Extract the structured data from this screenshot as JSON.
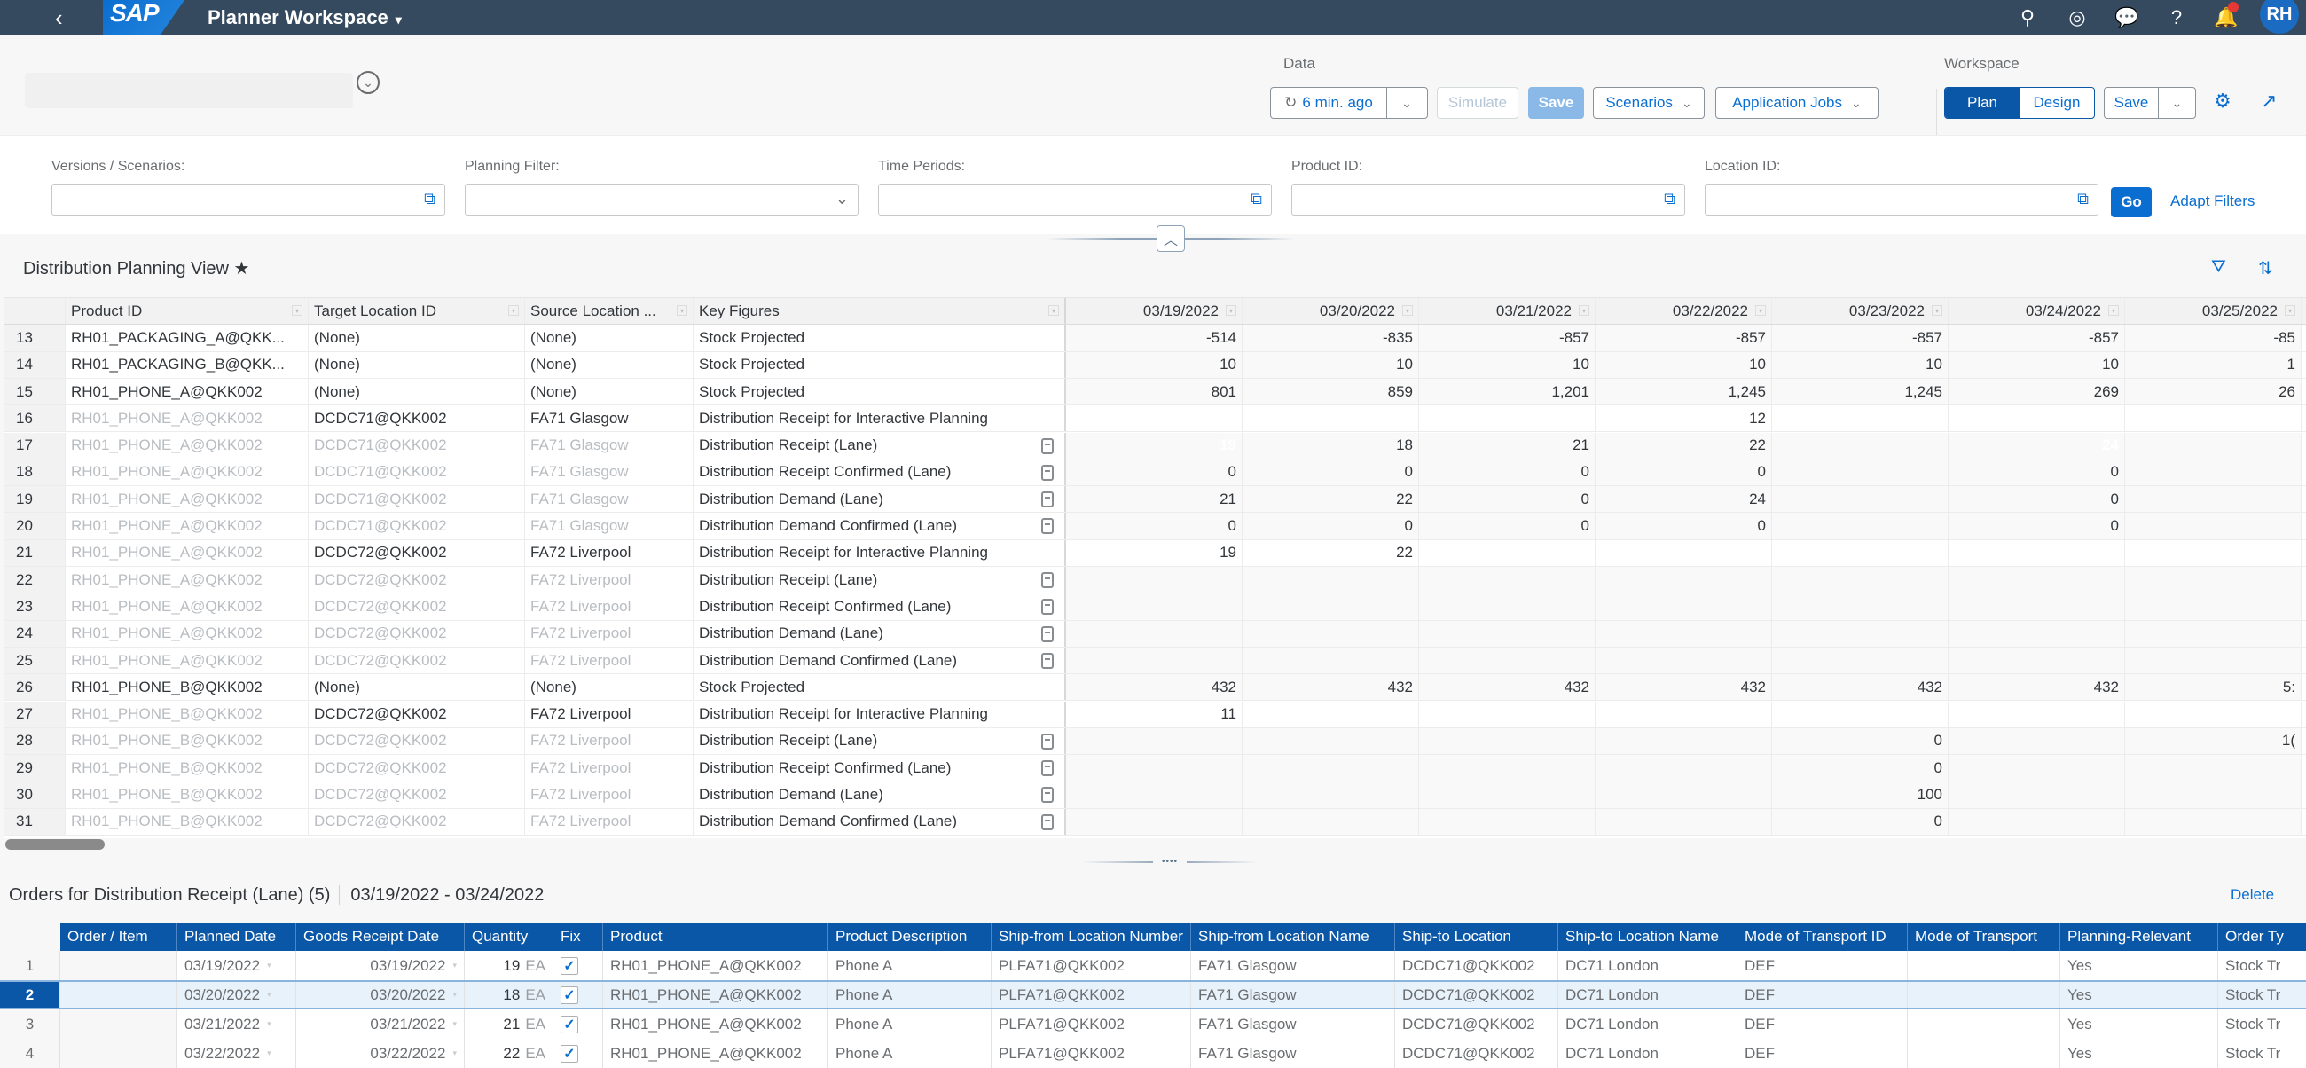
{
  "shell": {
    "back_icon": "chevron-left-icon",
    "logo": "SAP",
    "title": "Planner Workspace",
    "title_caret": "▾",
    "icons": [
      {
        "name": "search-icon",
        "glyph": "⚲"
      },
      {
        "name": "joule-icon",
        "glyph": "◎"
      },
      {
        "name": "feedback-icon",
        "glyph": "💬"
      },
      {
        "name": "help-icon",
        "glyph": "?"
      },
      {
        "name": "notifications-icon",
        "glyph": "🔔"
      }
    ],
    "avatar": "RH"
  },
  "header": {
    "data_group_label": "Data",
    "refresh_label": "6 min. ago",
    "simulate_label": "Simulate",
    "save_label": "Save",
    "scenarios_label": "Scenarios",
    "application_jobs_label": "Application Jobs",
    "workspace_group_label": "Workspace",
    "plan_label": "Plan",
    "design_label": "Design",
    "workspace_save_label": "Save"
  },
  "filters": [
    {
      "label": "Versions / Scenarios:",
      "value": "",
      "icon": "value-help-icon"
    },
    {
      "label": "Planning Filter:",
      "value": "",
      "icon": "chevron-down-icon"
    },
    {
      "label": "Time Periods:",
      "value": "",
      "icon": "value-help-icon"
    },
    {
      "label": "Product ID:",
      "value": "",
      "icon": "value-help-icon"
    },
    {
      "label": "Location ID:",
      "value": "",
      "icon": "value-help-icon"
    }
  ],
  "filter_actions": {
    "go": "Go",
    "adapt": "Adapt Filters"
  },
  "planning_view": {
    "title": "Distribution Planning View ★",
    "columns": [
      "Product ID",
      "Target Location ID",
      "Source Location ...",
      "Key Figures"
    ],
    "dates": [
      "03/19/2022",
      "03/20/2022",
      "03/21/2022",
      "03/22/2022",
      "03/23/2022",
      "03/24/2022",
      "03/25/2022"
    ],
    "rows": [
      {
        "n": "13",
        "product": "RH01_PACKAGING_A@QKK...",
        "target": "(None)",
        "source": "(None)",
        "kf": "Stock Projected",
        "dim": [
          false,
          false,
          false
        ],
        "lock": false,
        "white": false,
        "values": [
          "-514",
          "-835",
          "-857",
          "-857",
          "-857",
          "-857",
          "-85"
        ]
      },
      {
        "n": "14",
        "product": "RH01_PACKAGING_B@QKK...",
        "target": "(None)",
        "source": "(None)",
        "kf": "Stock Projected",
        "dim": [
          false,
          false,
          false
        ],
        "lock": false,
        "white": false,
        "values": [
          "10",
          "10",
          "10",
          "10",
          "10",
          "10",
          "1"
        ]
      },
      {
        "n": "15",
        "product": "RH01_PHONE_A@QKK002",
        "target": "(None)",
        "source": "(None)",
        "kf": "Stock Projected",
        "dim": [
          false,
          false,
          false
        ],
        "lock": false,
        "white": false,
        "values": [
          "801",
          "859",
          "1,201",
          "1,245",
          "1,245",
          "269",
          "26"
        ]
      },
      {
        "n": "16",
        "product": "RH01_PHONE_A@QKK002",
        "target": "DCDC71@QKK002",
        "source": "FA71 Glasgow",
        "kf": "Distribution Receipt for Interactive Planning",
        "dim": [
          true,
          false,
          false
        ],
        "lock": false,
        "white": true,
        "values": [
          "",
          "",
          "",
          "12",
          "",
          "",
          ""
        ]
      },
      {
        "n": "17",
        "product": "RH01_PHONE_A@QKK002",
        "target": "DCDC71@QKK002",
        "source": "FA71 Glasgow",
        "kf": "Distribution Receipt (Lane)",
        "dim": [
          true,
          true,
          true
        ],
        "lock": true,
        "white": false,
        "values": [
          "19",
          "18",
          "21",
          "22",
          "",
          "24",
          ""
        ],
        "selected": [
          0,
          5
        ]
      },
      {
        "n": "18",
        "product": "RH01_PHONE_A@QKK002",
        "target": "DCDC71@QKK002",
        "source": "FA71 Glasgow",
        "kf": "Distribution Receipt Confirmed (Lane)",
        "dim": [
          true,
          true,
          true
        ],
        "lock": true,
        "white": false,
        "values": [
          "0",
          "0",
          "0",
          "0",
          "",
          "0",
          ""
        ]
      },
      {
        "n": "19",
        "product": "RH01_PHONE_A@QKK002",
        "target": "DCDC71@QKK002",
        "source": "FA71 Glasgow",
        "kf": "Distribution Demand (Lane)",
        "dim": [
          true,
          true,
          true
        ],
        "lock": true,
        "white": false,
        "values": [
          "21",
          "22",
          "0",
          "24",
          "",
          "0",
          ""
        ]
      },
      {
        "n": "20",
        "product": "RH01_PHONE_A@QKK002",
        "target": "DCDC71@QKK002",
        "source": "FA71 Glasgow",
        "kf": "Distribution Demand Confirmed (Lane)",
        "dim": [
          true,
          true,
          true
        ],
        "lock": true,
        "white": false,
        "values": [
          "0",
          "0",
          "0",
          "0",
          "",
          "0",
          ""
        ]
      },
      {
        "n": "21",
        "product": "RH01_PHONE_A@QKK002",
        "target": "DCDC72@QKK002",
        "source": "FA72 Liverpool",
        "kf": "Distribution Receipt for Interactive Planning",
        "dim": [
          true,
          false,
          false
        ],
        "lock": false,
        "white": true,
        "values": [
          "19",
          "22",
          "",
          "",
          "",
          "",
          ""
        ]
      },
      {
        "n": "22",
        "product": "RH01_PHONE_A@QKK002",
        "target": "DCDC72@QKK002",
        "source": "FA72 Liverpool",
        "kf": "Distribution Receipt (Lane)",
        "dim": [
          true,
          true,
          true
        ],
        "lock": true,
        "white": false,
        "values": [
          "",
          "",
          "",
          "",
          "",
          "",
          ""
        ]
      },
      {
        "n": "23",
        "product": "RH01_PHONE_A@QKK002",
        "target": "DCDC72@QKK002",
        "source": "FA72 Liverpool",
        "kf": "Distribution Receipt Confirmed (Lane)",
        "dim": [
          true,
          true,
          true
        ],
        "lock": true,
        "white": false,
        "values": [
          "",
          "",
          "",
          "",
          "",
          "",
          ""
        ]
      },
      {
        "n": "24",
        "product": "RH01_PHONE_A@QKK002",
        "target": "DCDC72@QKK002",
        "source": "FA72 Liverpool",
        "kf": "Distribution Demand (Lane)",
        "dim": [
          true,
          true,
          true
        ],
        "lock": true,
        "white": false,
        "values": [
          "",
          "",
          "",
          "",
          "",
          "",
          ""
        ]
      },
      {
        "n": "25",
        "product": "RH01_PHONE_A@QKK002",
        "target": "DCDC72@QKK002",
        "source": "FA72 Liverpool",
        "kf": "Distribution Demand Confirmed (Lane)",
        "dim": [
          true,
          true,
          true
        ],
        "lock": true,
        "white": false,
        "values": [
          "",
          "",
          "",
          "",
          "",
          "",
          ""
        ]
      },
      {
        "n": "26",
        "product": "RH01_PHONE_B@QKK002",
        "target": "(None)",
        "source": "(None)",
        "kf": "Stock Projected",
        "dim": [
          false,
          false,
          false
        ],
        "lock": false,
        "white": false,
        "values": [
          "432",
          "432",
          "432",
          "432",
          "432",
          "432",
          "5:"
        ]
      },
      {
        "n": "27",
        "product": "RH01_PHONE_B@QKK002",
        "target": "DCDC72@QKK002",
        "source": "FA72 Liverpool",
        "kf": "Distribution Receipt for Interactive Planning",
        "dim": [
          true,
          false,
          false
        ],
        "lock": false,
        "white": true,
        "values": [
          "11",
          "",
          "",
          "",
          "",
          "",
          ""
        ]
      },
      {
        "n": "28",
        "product": "RH01_PHONE_B@QKK002",
        "target": "DCDC72@QKK002",
        "source": "FA72 Liverpool",
        "kf": "Distribution Receipt (Lane)",
        "dim": [
          true,
          true,
          true
        ],
        "lock": true,
        "white": false,
        "values": [
          "",
          "",
          "",
          "",
          "0",
          "",
          "1("
        ]
      },
      {
        "n": "29",
        "product": "RH01_PHONE_B@QKK002",
        "target": "DCDC72@QKK002",
        "source": "FA72 Liverpool",
        "kf": "Distribution Receipt Confirmed (Lane)",
        "dim": [
          true,
          true,
          true
        ],
        "lock": true,
        "white": false,
        "values": [
          "",
          "",
          "",
          "",
          "0",
          "",
          ""
        ]
      },
      {
        "n": "30",
        "product": "RH01_PHONE_B@QKK002",
        "target": "DCDC72@QKK002",
        "source": "FA72 Liverpool",
        "kf": "Distribution Demand (Lane)",
        "dim": [
          true,
          true,
          true
        ],
        "lock": true,
        "white": false,
        "values": [
          "",
          "",
          "",
          "",
          "100",
          "",
          ""
        ]
      },
      {
        "n": "31",
        "product": "RH01_PHONE_B@QKK002",
        "target": "DCDC72@QKK002",
        "source": "FA72 Liverpool",
        "kf": "Distribution Demand Confirmed (Lane)",
        "dim": [
          true,
          true,
          true
        ],
        "lock": true,
        "white": false,
        "values": [
          "",
          "",
          "",
          "",
          "0",
          "",
          ""
        ]
      }
    ]
  },
  "orders": {
    "title": "Orders for Distribution Receipt (Lane) (5)",
    "range": "03/19/2022 - 03/24/2022",
    "delete_label": "Delete",
    "columns": [
      "Order / Item",
      "Planned Date",
      "Goods Receipt Date",
      "Quantity",
      "Fix",
      "Product",
      "Product Description",
      "Ship-from Location Number",
      "Ship-from Location Name",
      "Ship-to Location",
      "Ship-to Location Name",
      "Mode of Transport ID",
      "Mode of Transport",
      "Planning-Relevant",
      "Order Ty"
    ],
    "rows": [
      {
        "n": "1",
        "order": "",
        "planned": "03/19/2022",
        "gr": "03/19/2022",
        "qty": "19",
        "unit": "EA",
        "fix": true,
        "product": "RH01_PHONE_A@QKK002",
        "desc": "Phone A",
        "from_num": "PLFA71@QKK002",
        "from_name": "FA71 Glasgow",
        "to_loc": "DCDC71@QKK002",
        "to_name": "DC71 London",
        "mot_id": "DEF",
        "mot": "",
        "relevant": "Yes",
        "otype": "Stock Tr",
        "selected": false
      },
      {
        "n": "2",
        "order": "",
        "planned": "03/20/2022",
        "gr": "03/20/2022",
        "qty": "18",
        "unit": "EA",
        "fix": true,
        "product": "RH01_PHONE_A@QKK002",
        "desc": "Phone A",
        "from_num": "PLFA71@QKK002",
        "from_name": "FA71 Glasgow",
        "to_loc": "DCDC71@QKK002",
        "to_name": "DC71 London",
        "mot_id": "DEF",
        "mot": "",
        "relevant": "Yes",
        "otype": "Stock Tr",
        "selected": true
      },
      {
        "n": "3",
        "order": "",
        "planned": "03/21/2022",
        "gr": "03/21/2022",
        "qty": "21",
        "unit": "EA",
        "fix": true,
        "product": "RH01_PHONE_A@QKK002",
        "desc": "Phone A",
        "from_num": "PLFA71@QKK002",
        "from_name": "FA71 Glasgow",
        "to_loc": "DCDC71@QKK002",
        "to_name": "DC71 London",
        "mot_id": "DEF",
        "mot": "",
        "relevant": "Yes",
        "otype": "Stock Tr",
        "selected": false
      },
      {
        "n": "4",
        "order": "",
        "planned": "03/22/2022",
        "gr": "03/22/2022",
        "qty": "22",
        "unit": "EA",
        "fix": true,
        "product": "RH01_PHONE_A@QKK002",
        "desc": "Phone A",
        "from_num": "PLFA71@QKK002",
        "from_name": "FA71 Glasgow",
        "to_loc": "DCDC71@QKK002",
        "to_name": "DC71 London",
        "mot_id": "DEF",
        "mot": "",
        "relevant": "Yes",
        "otype": "Stock Tr",
        "selected": false
      }
    ]
  }
}
